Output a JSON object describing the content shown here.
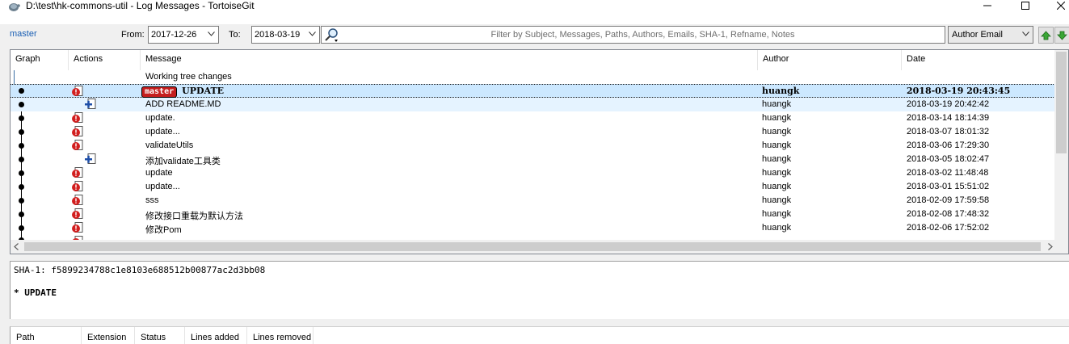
{
  "window": {
    "title": "D:\\test\\hk-commons-util - Log Messages - TortoiseGit"
  },
  "filter": {
    "branch": "master",
    "from_label": "From:",
    "from_date": "2017-12-26",
    "to_label": "To:",
    "to_date": "2018-03-19",
    "search_placeholder": "Filter by Subject, Messages, Paths, Authors, Emails, SHA-1, Refname, Notes",
    "search_field": "Author Email"
  },
  "log": {
    "columns": [
      "Graph",
      "Actions",
      "Message",
      "Author",
      "Date"
    ],
    "working_tree": "Working tree changes",
    "rows": [
      {
        "ref": "master",
        "message": "UPDATE",
        "author": "huangk",
        "date": "2018-03-19 20:43:45",
        "action": "modify-icon"
      },
      {
        "message": "ADD README.MD",
        "author": "huangk",
        "date": "2018-03-19 20:42:42",
        "action": "add-icon"
      },
      {
        "message": "update.",
        "author": "huangk",
        "date": "2018-03-14 18:14:39",
        "action": "modify-icon"
      },
      {
        "message": "update...",
        "author": "huangk",
        "date": "2018-03-07 18:01:32",
        "action": "modify-icon"
      },
      {
        "message": "validateUtils",
        "author": "huangk",
        "date": "2018-03-06 17:29:30",
        "action": "modify-icon"
      },
      {
        "message": "添加validate工具类",
        "author": "huangk",
        "date": "2018-03-05 18:02:47",
        "action": "add-icon"
      },
      {
        "message": "update",
        "author": "huangk",
        "date": "2018-03-02 11:48:48",
        "action": "modify-icon"
      },
      {
        "message": "update...",
        "author": "huangk",
        "date": "2018-03-01 15:51:02",
        "action": "modify-icon"
      },
      {
        "message": "sss",
        "author": "huangk",
        "date": "2018-02-09 17:59:58",
        "action": "modify-icon"
      },
      {
        "message": "修改接口重载为默认方法",
        "author": "huangk",
        "date": "2018-02-08 17:48:32",
        "action": "modify-icon"
      },
      {
        "message": "修改Pom",
        "author": "huangk",
        "date": "2018-02-06 17:52:02",
        "action": "modify-icon"
      }
    ]
  },
  "details": {
    "sha": "SHA-1: f5899234788c1e8103e688512b00877ac2d3bb08",
    "message": "* UPDATE"
  },
  "files": {
    "columns": [
      "Path",
      "Extension",
      "Status",
      "Lines added",
      "Lines removed"
    ]
  },
  "colors": {
    "selection": "#cce8ff",
    "ref_tag": "#c41e1e",
    "branch_link": "#1a5fb4"
  }
}
